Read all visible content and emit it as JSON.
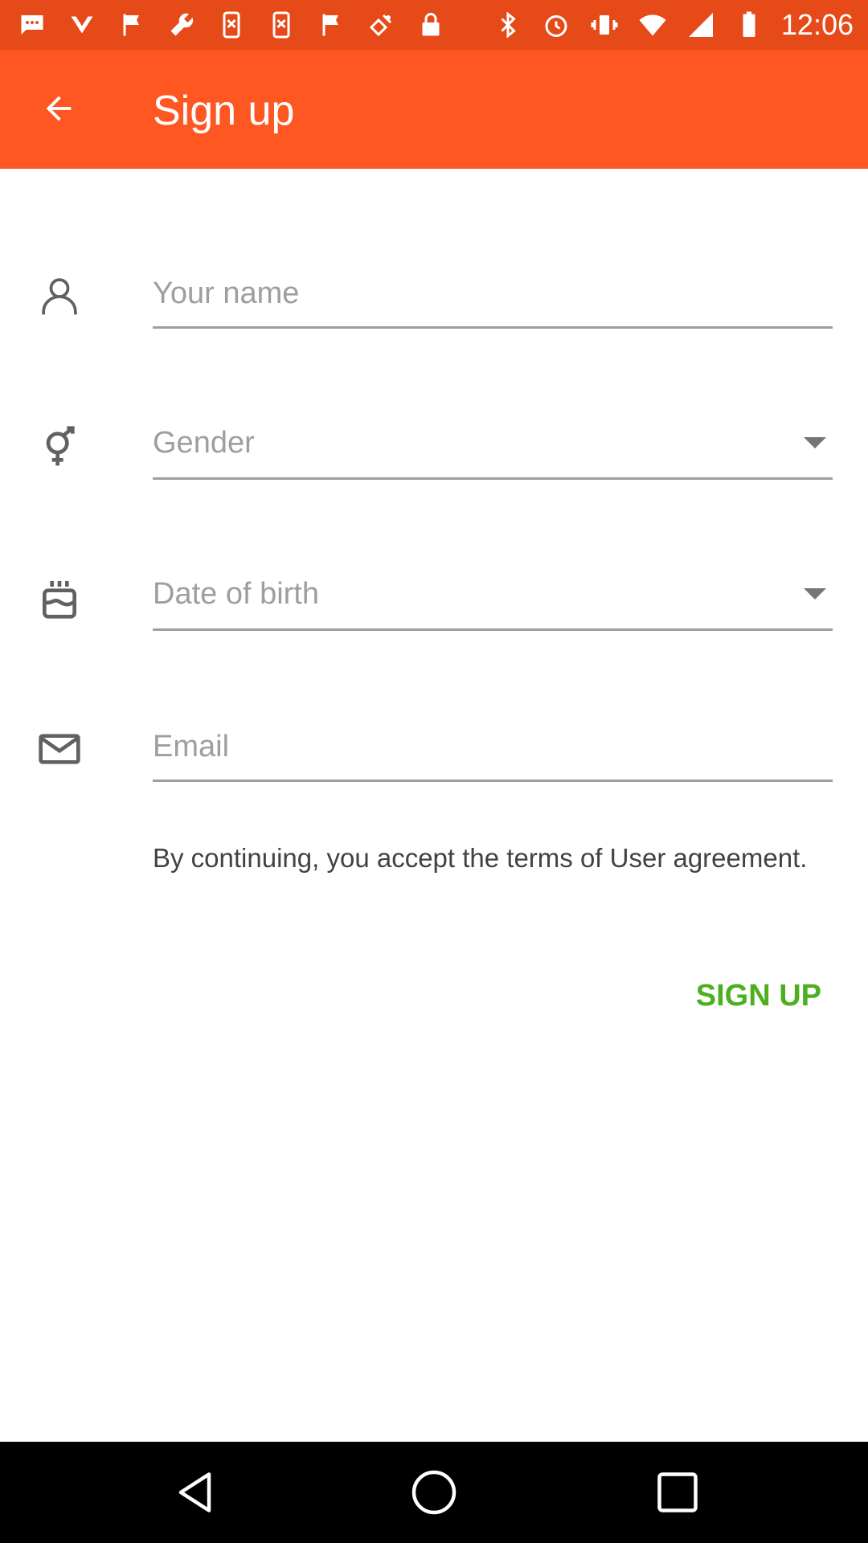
{
  "status_bar": {
    "time": "12:06",
    "left_icons": [
      "chat-bubble-icon",
      "check-down-icon",
      "flag-icon",
      "wrench-icon",
      "phone-tool-icon",
      "phone-tool-icon",
      "flag-icon",
      "satellite-fake-icon",
      "lock-icon"
    ],
    "right_icons": [
      "bluetooth-icon",
      "alarm-icon",
      "vibrate-icon",
      "wifi-icon",
      "signal-icon",
      "battery-icon"
    ],
    "colors": {
      "background": "#e64a19"
    }
  },
  "app_bar": {
    "title": "Sign up",
    "back_icon": "arrow-back-icon",
    "color": "#ff5722"
  },
  "form": {
    "name": {
      "icon": "person-icon",
      "placeholder": "Your name",
      "value": ""
    },
    "gender": {
      "icon": "gender-icon",
      "placeholder": "Gender"
    },
    "dob": {
      "icon": "birthday-cake-icon",
      "placeholder": "Date of birth"
    },
    "email": {
      "icon": "envelope-icon",
      "placeholder": "Email",
      "value": ""
    }
  },
  "terms_text": "By continuing, you accept the terms of User agreement.",
  "signup_label": "SIGN UP",
  "colors": {
    "accent": "#4caf20",
    "divider": "#9e9e9e"
  },
  "nav_bar": {
    "icons": [
      "back-triangle-icon",
      "home-circle-icon",
      "recents-square-icon"
    ]
  }
}
